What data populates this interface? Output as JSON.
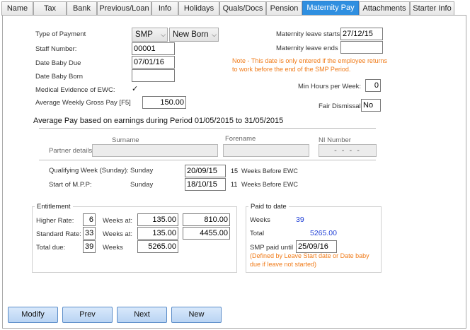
{
  "tabs": [
    "Name",
    "Tax",
    "Bank",
    "Previous/Loan",
    "Info",
    "Holidays",
    "Quals/Docs",
    "Pension",
    "Maternity Pay",
    "Attachments",
    "Starter Info"
  ],
  "left": {
    "type_of_payment_label": "Type of Payment",
    "payment_type": "SMP",
    "birth_type": "New Born",
    "staff_number_label": "Staff Number:",
    "staff_number": "00001",
    "date_baby_due_label": "Date Baby Due",
    "date_baby_due": "07/01/16",
    "date_baby_born_label": "Date Baby Born",
    "date_baby_born": "",
    "medical_evidence_label": "Medical Evidence of EWC:",
    "medical_evidence_mark": "✓",
    "avg_weekly_gross_label": "Average Weekly Gross Pay [F5]",
    "avg_weekly_gross": "150.00"
  },
  "right": {
    "leave_starts_label": "Maternity leave starts",
    "leave_starts": "27/12/15",
    "leave_ends_label": "Maternity leave ends",
    "leave_ends": "",
    "note": "Note - This date is only entered if the employee returns to work before the end of the SMP Period.",
    "min_hours_label": "Min Hours per Week:",
    "min_hours": "0",
    "fair_dismissal_label": "Fair Dismissal:",
    "fair_dismissal": "No"
  },
  "avg_pay_heading": "Average Pay based on earnings during Period 01/05/2015 to 31/05/2015",
  "partner": {
    "surname_label": "Surname",
    "forename_label": "Forename",
    "ni_label": "NI Number",
    "row_label": "Partner details",
    "surname": "",
    "forename": "",
    "ni": "- - - -"
  },
  "qualifying": {
    "qw_label": "Qualifying Week (Sunday):",
    "qw_day": "Sunday",
    "qw_date": "20/09/15",
    "qw_weeks": "15",
    "qw_suffix": "Weeks Before EWC",
    "mpp_label": "Start of M.P.P:",
    "mpp_day": "Sunday",
    "mpp_date": "18/10/15",
    "mpp_weeks": "11",
    "mpp_suffix": "Weeks Before EWC"
  },
  "entitlement": {
    "title": "Entitlement",
    "higher_label": "Higher Rate:",
    "higher_weeks": "6",
    "higher_weeks_at": "Weeks at:",
    "higher_rate": "135.00",
    "higher_total": "810.00",
    "standard_label": "Standard Rate:",
    "standard_weeks": "33",
    "standard_weeks_at": "Weeks at:",
    "standard_rate": "135.00",
    "standard_total": "4455.00",
    "total_label": "Total due:",
    "total_weeks": "39",
    "total_weeks_label": "Weeks",
    "total_amount": "5265.00"
  },
  "paid": {
    "title": "Paid to date",
    "weeks_label": "Weeks",
    "weeks": "39",
    "total_label": "Total",
    "total": "5265.00",
    "smp_paid_label": "SMP paid until",
    "smp_paid_until": "25/09/16",
    "note": "(Defined by Leave Start date or Date baby due if leave not started)"
  },
  "buttons": {
    "modify": "Modify",
    "prev": "Prev",
    "next": "Next",
    "new": "New"
  }
}
